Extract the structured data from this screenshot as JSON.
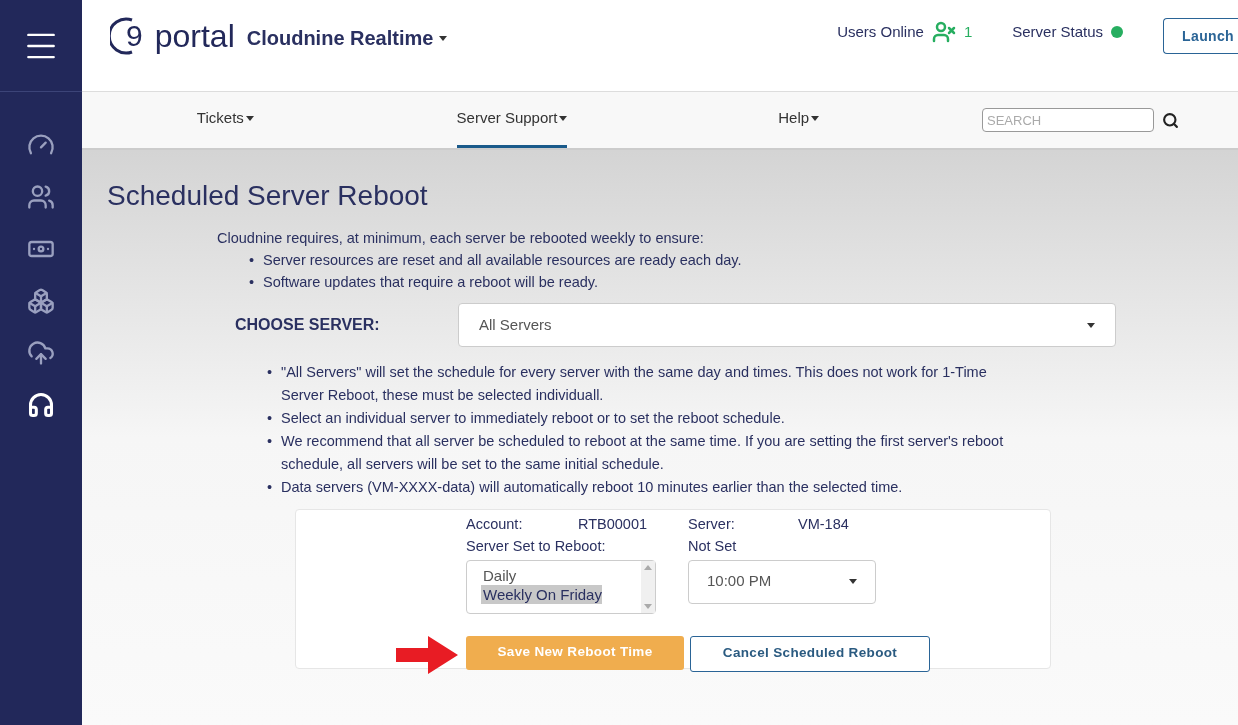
{
  "bullet": "•",
  "sidebar": {
    "items": [
      {
        "kind": "gauge",
        "selected": false
      },
      {
        "kind": "users",
        "selected": false
      },
      {
        "kind": "money",
        "selected": false
      },
      {
        "kind": "cubes",
        "selected": false
      },
      {
        "kind": "cloud",
        "selected": false
      },
      {
        "kind": "headset",
        "selected": true
      }
    ]
  },
  "header": {
    "logo_mark": "9",
    "logo_text": "portal",
    "company": "Cloudnine Realtime",
    "users_online_label": "Users Online",
    "users_online_count": "1",
    "server_status_label": "Server Status",
    "server_online": true,
    "launch_button": "Launch"
  },
  "nav": {
    "tabs": [
      {
        "label": "Tickets",
        "selected": false
      },
      {
        "label": "Server Support",
        "selected": true
      },
      {
        "label": "Help",
        "selected": false
      }
    ],
    "search": {
      "placeholder": "SEARCH"
    }
  },
  "page": {
    "title": "Scheduled Server Reboot",
    "intro": "Cloudnine requires, at minimum, each server be rebooted weekly to ensure:",
    "intro_bullets": [
      "Server resources are reset and all available resources are ready each day.",
      "Software updates that require a reboot will be ready."
    ],
    "choose_label": "CHOOSE SERVER:",
    "choose_value": "All Servers",
    "notes": [
      "\"All Servers\" will set the schedule for every server with the same day and times. This does not work for 1-Time Server Reboot, these must be selected individuall.",
      "Select an individual server to immediately reboot or to set the reboot schedule.",
      "We recommend that all server be scheduled to reboot at the same time. If you are setting the first server's reboot schedule, all servers will be set to the same initial schedule.",
      "Data servers (VM-XXXX-data) will automatically reboot 10 minutes earlier than the selected time."
    ],
    "card": {
      "account_label": "Account:",
      "account_value": "RTB00001",
      "server_label": "Server:",
      "server_value": "VM-184",
      "set_label": "Server Set to Reboot:",
      "set_value": "Not Set",
      "frequency_options": [
        {
          "label": "Daily",
          "selected": false
        },
        {
          "label": "Weekly On Friday",
          "selected": true
        }
      ],
      "time_value": "10:00 PM",
      "save_button": "Save New Reboot Time",
      "cancel_button": "Cancel Scheduled Reboot"
    }
  }
}
